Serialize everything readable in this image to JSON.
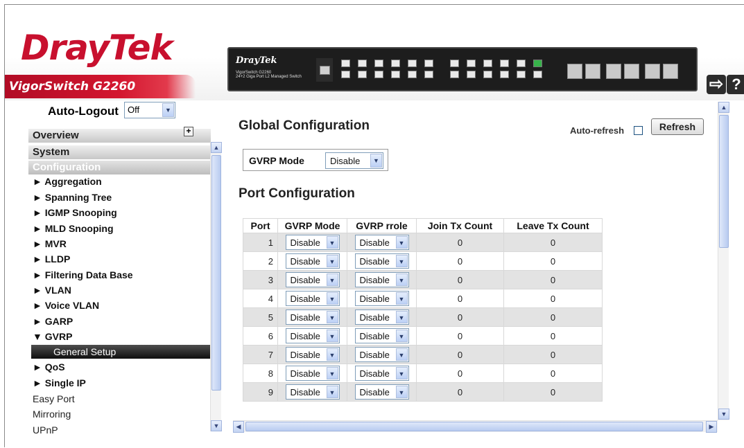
{
  "header": {
    "brand_dray": "Dray",
    "brand_tek": "Tek",
    "model": "VigorSwitch G2260",
    "device_brand": "DrayTek",
    "device_model": "VigorSwitch G2260",
    "device_subtitle": "24+2 Giga Port L2 Managed Switch"
  },
  "menu": {
    "autologout_label": "Auto-Logout",
    "autologout_value": "Off",
    "sections": {
      "overview": "Overview",
      "system": "System",
      "configuration": "Configuration"
    },
    "items": [
      "► Aggregation",
      "► Spanning Tree",
      "► IGMP Snooping",
      "► MLD Snooping",
      "► MVR",
      "► LLDP",
      "► Filtering Data Base",
      "► VLAN",
      "► Voice VLAN",
      "► GARP",
      "▼ GVRP"
    ],
    "active_subitem": "General Setup",
    "items_after": [
      "► QoS",
      "► Single IP"
    ],
    "plain_items": [
      "Easy Port",
      "Mirroring",
      "UPnP"
    ]
  },
  "main": {
    "global_title": "Global Configuration",
    "autorefresh_label": "Auto-refresh",
    "autorefresh_checked": false,
    "refresh_label": "Refresh",
    "gvrp_mode_label": "GVRP Mode",
    "gvrp_mode_value": "Disable",
    "port_title": "Port Configuration",
    "columns": [
      "Port",
      "GVRP Mode",
      "GVRP rrole",
      "Join Tx Count",
      "Leave Tx Count"
    ],
    "rows": [
      {
        "port": "1",
        "mode": "Disable",
        "role": "Disable",
        "join": "0",
        "leave": "0"
      },
      {
        "port": "2",
        "mode": "Disable",
        "role": "Disable",
        "join": "0",
        "leave": "0"
      },
      {
        "port": "3",
        "mode": "Disable",
        "role": "Disable",
        "join": "0",
        "leave": "0"
      },
      {
        "port": "4",
        "mode": "Disable",
        "role": "Disable",
        "join": "0",
        "leave": "0"
      },
      {
        "port": "5",
        "mode": "Disable",
        "role": "Disable",
        "join": "0",
        "leave": "0"
      },
      {
        "port": "6",
        "mode": "Disable",
        "role": "Disable",
        "join": "0",
        "leave": "0"
      },
      {
        "port": "7",
        "mode": "Disable",
        "role": "Disable",
        "join": "0",
        "leave": "0"
      },
      {
        "port": "8",
        "mode": "Disable",
        "role": "Disable",
        "join": "0",
        "leave": "0"
      },
      {
        "port": "9",
        "mode": "Disable",
        "role": "Disable",
        "join": "0",
        "leave": "0"
      }
    ]
  },
  "icons": [
    "logout-icon",
    "help-icon",
    "plus-icon",
    "chevron-down-icon"
  ],
  "colors": {
    "brand_red": "#c8102e",
    "row_shade": "#e3e3e3",
    "active_menu": "#1a1a1a"
  }
}
